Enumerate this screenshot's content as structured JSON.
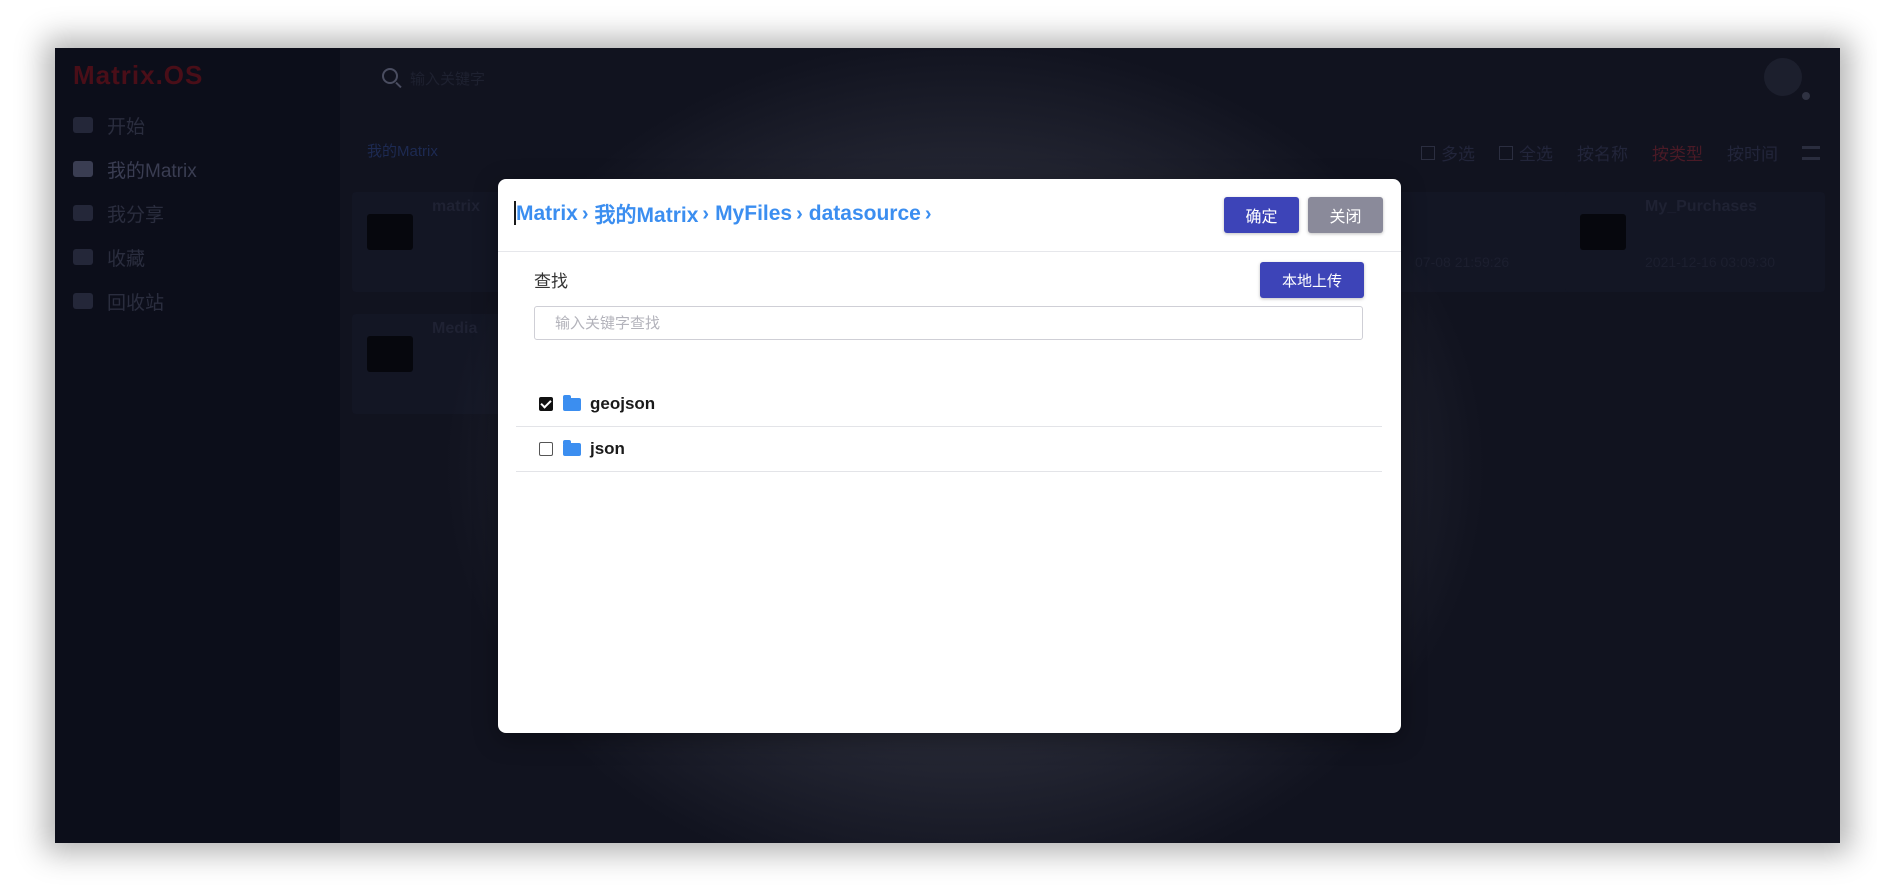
{
  "app": {
    "logo": "Matrix.OS",
    "nav": [
      {
        "label": "开始"
      },
      {
        "label": "我的Matrix"
      },
      {
        "label": "我分享"
      },
      {
        "label": "收藏"
      },
      {
        "label": "回收站"
      }
    ],
    "search_placeholder": "输入关键字",
    "breadcrumb": "我的Matrix",
    "toolbar": {
      "multi_select": "多选",
      "select_all": "全选",
      "sort_name": "按名称",
      "sort_type": "按类型",
      "sort_time": "按时间"
    },
    "cards": [
      {
        "title": "matrix",
        "sub": "",
        "date": ""
      },
      {
        "title": "",
        "sub": "",
        "date": "07-08 21:59:26"
      },
      {
        "title": "My_Purchases",
        "sub": "",
        "date": "2021-12-16 03:09:30"
      },
      {
        "title": "Media",
        "sub": "",
        "date": ""
      }
    ]
  },
  "modal": {
    "breadcrumbs": [
      "Matrix",
      "我的Matrix",
      "MyFiles",
      "datasource"
    ],
    "confirm_label": "确定",
    "close_label": "关闭",
    "search_label": "查找",
    "upload_label": "本地上传",
    "search_placeholder": "输入关键字查找",
    "files": [
      {
        "name": "geojson",
        "checked": true
      },
      {
        "name": "json",
        "checked": false
      }
    ]
  },
  "colors": {
    "accent": "#3b8ef0",
    "primary_button": "#3d44b8",
    "secondary_button": "#8a8a9a"
  }
}
